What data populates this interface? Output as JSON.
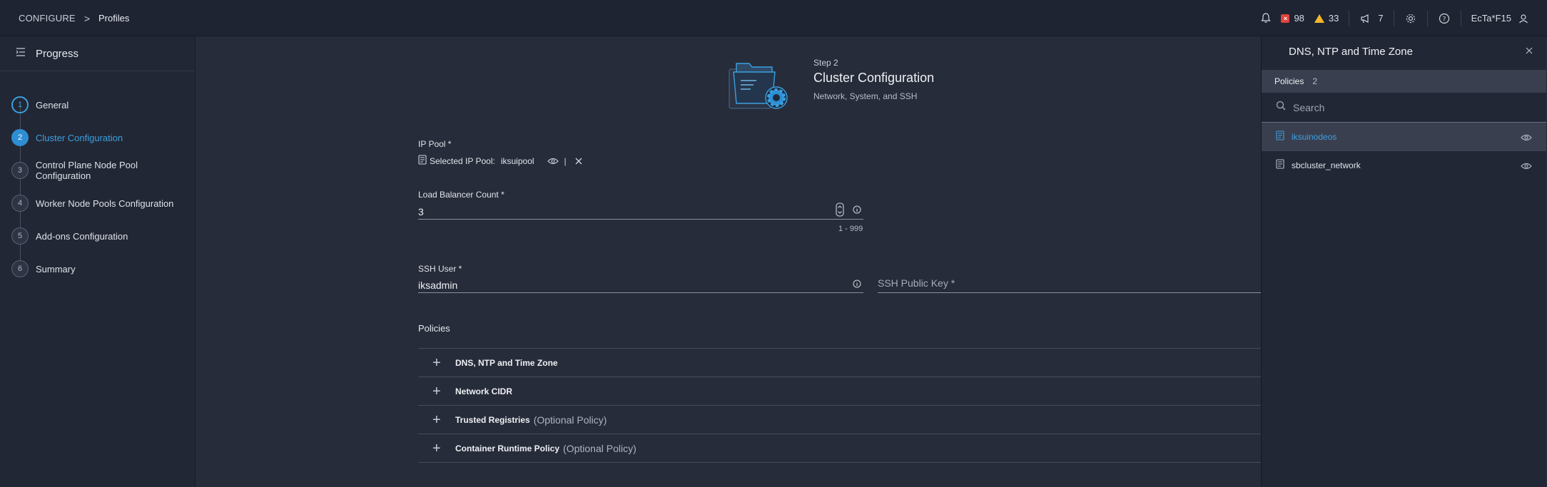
{
  "header": {
    "breadcrumb_root": "CONFIGURE",
    "breadcrumb_sep": ">",
    "breadcrumb_current": "Profiles",
    "alerts_critical": "98",
    "alerts_warning": "33",
    "announcements": "7",
    "user": "EcTa*F15"
  },
  "sidebar": {
    "title": "Progress",
    "steps": [
      {
        "num": "1",
        "label": "General"
      },
      {
        "num": "2",
        "label": "Cluster Configuration"
      },
      {
        "num": "3",
        "label": "Control Plane Node Pool Configuration"
      },
      {
        "num": "4",
        "label": "Worker Node Pools Configuration"
      },
      {
        "num": "5",
        "label": "Add-ons Configuration"
      },
      {
        "num": "6",
        "label": "Summary"
      }
    ]
  },
  "main": {
    "step_label": "Step 2",
    "step_title": "Cluster Configuration",
    "step_subtitle": "Network, System, and SSH",
    "ip_pool_label": "IP Pool *",
    "ip_pool_selected_label": "Selected IP Pool:",
    "ip_pool_value": "iksuipool",
    "ip_pool_divider": "|",
    "lb_label": "Load Balancer Count *",
    "lb_value": "3",
    "lb_range": "1 - 999",
    "ssh_user_label": "SSH User *",
    "ssh_user_value": "iksadmin",
    "ssh_key_placeholder": "SSH Public Key *",
    "policies_title": "Policies",
    "policies": [
      {
        "name": "DNS, NTP and Time Zone",
        "optional": ""
      },
      {
        "name": "Network CIDR",
        "optional": ""
      },
      {
        "name": "Trusted Registries",
        "optional": "(Optional Policy)"
      },
      {
        "name": "Container Runtime Policy",
        "optional": "(Optional Policy)"
      }
    ]
  },
  "panel": {
    "title": "DNS, NTP and Time Zone",
    "tab_label": "Policies",
    "tab_count": "2",
    "search_placeholder": "Search",
    "items": [
      {
        "name": "iksuinodeos"
      },
      {
        "name": "sbcluster_network"
      }
    ]
  },
  "colors": {
    "accent": "#3aa0e0",
    "background": "#272c3a",
    "error": "#e0443c",
    "warning": "#f5b72b"
  }
}
